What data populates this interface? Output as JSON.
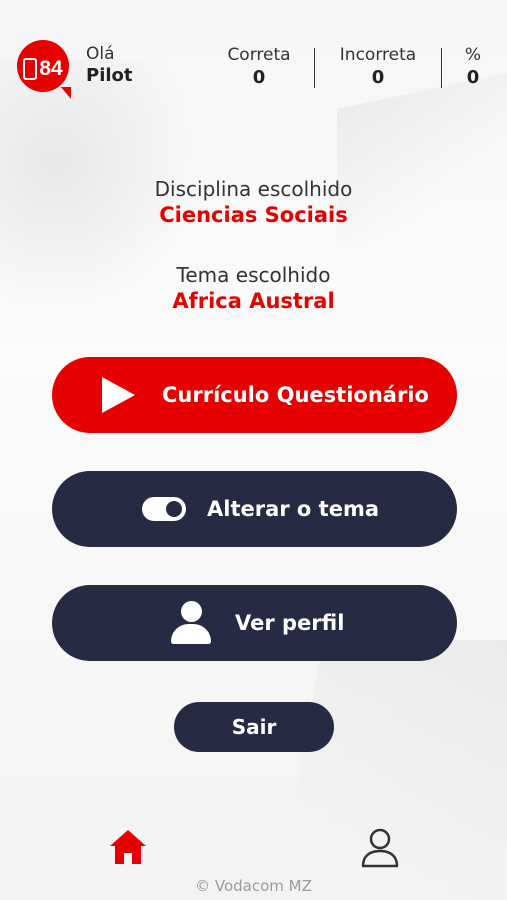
{
  "header": {
    "logo_number": "84",
    "greeting": "Olá",
    "user_name": "Pilot",
    "stats": [
      {
        "label": "Correta",
        "value": "0"
      },
      {
        "label": "Incorreta",
        "value": "0"
      },
      {
        "label": "%",
        "value": "0"
      }
    ]
  },
  "selection": {
    "discipline_label": "Disciplina escolhido",
    "discipline_value": "Ciencias Sociais",
    "theme_label": "Tema escolhido",
    "theme_value": "Africa Austral"
  },
  "buttons": {
    "quiz": "Currículo Questionário",
    "change_theme": "Alterar o tema",
    "profile": "Ver perfil",
    "logout": "Sair"
  },
  "nav": {
    "active_color": "#e60000",
    "inactive_color": "#333333",
    "home_icon": "home-icon",
    "profile_icon": "user-outline-icon"
  },
  "footer": "© Vodacom MZ",
  "colors": {
    "brand_red": "#e60000",
    "navy": "#272a43"
  }
}
